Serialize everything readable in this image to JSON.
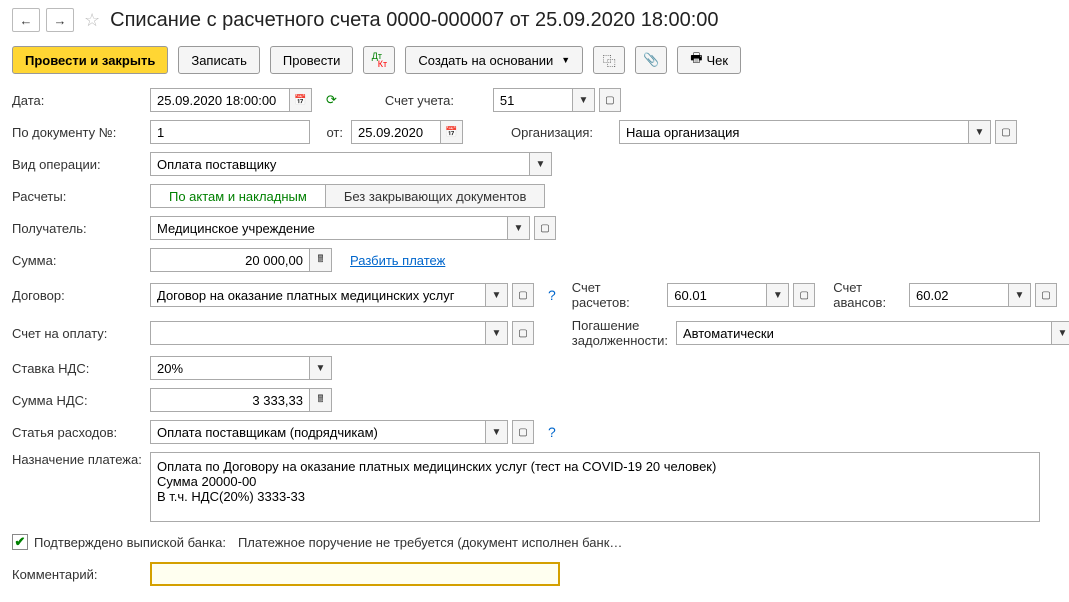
{
  "header": {
    "title": "Списание с расчетного счета 0000-000007 от 25.09.2020 18:00:00"
  },
  "actions": {
    "post_close": "Провести и закрыть",
    "save": "Записать",
    "post": "Провести",
    "create_based": "Создать на основании",
    "check": "Чек"
  },
  "labels": {
    "date": "Дата:",
    "doc_num": "По документу №:",
    "from": "от:",
    "op_type": "Вид операции:",
    "calc": "Расчеты:",
    "recipient": "Получатель:",
    "sum": "Сумма:",
    "split": "Разбить платеж",
    "contract": "Договор:",
    "invoice": "Счет на оплату:",
    "vat_rate": "Ставка НДС:",
    "vat_sum": "Сумма НДС:",
    "expense": "Статья расходов:",
    "purpose": "Назначение платежа:",
    "account": "Счет учета:",
    "org": "Организация:",
    "settle_acc": "Счет расчетов:",
    "advance_acc": "Счет авансов:",
    "debt": "Погашение задолженности:",
    "confirmed": "Подтверждено выпиской банка:",
    "bank_status": "Платежное поручение не требуется (документ исполнен банк…",
    "comment": "Комментарий:"
  },
  "toggle": {
    "by_acts": "По актам и накладным",
    "no_docs": "Без закрывающих документов"
  },
  "values": {
    "date": "25.09.2020 18:00:00",
    "doc_num": "1",
    "doc_date": "25.09.2020",
    "op_type": "Оплата поставщику",
    "recipient": "Медицинское учреждение",
    "sum": "20 000,00",
    "contract": "Договор на оказание платных медицинских услуг",
    "vat_rate": "20%",
    "vat_sum": "3 333,33",
    "expense": "Оплата поставщикам (подрядчикам)",
    "purpose": "Оплата по Договору на оказание платных медицинских услуг (тест на COVID-19 20 человек)\nСумма 20000-00\nВ т.ч. НДС(20%) 3333-33",
    "account": "51",
    "org": "Наша организация",
    "settle_acc": "60.01",
    "advance_acc": "60.02",
    "debt": "Автоматически",
    "comment": ""
  }
}
